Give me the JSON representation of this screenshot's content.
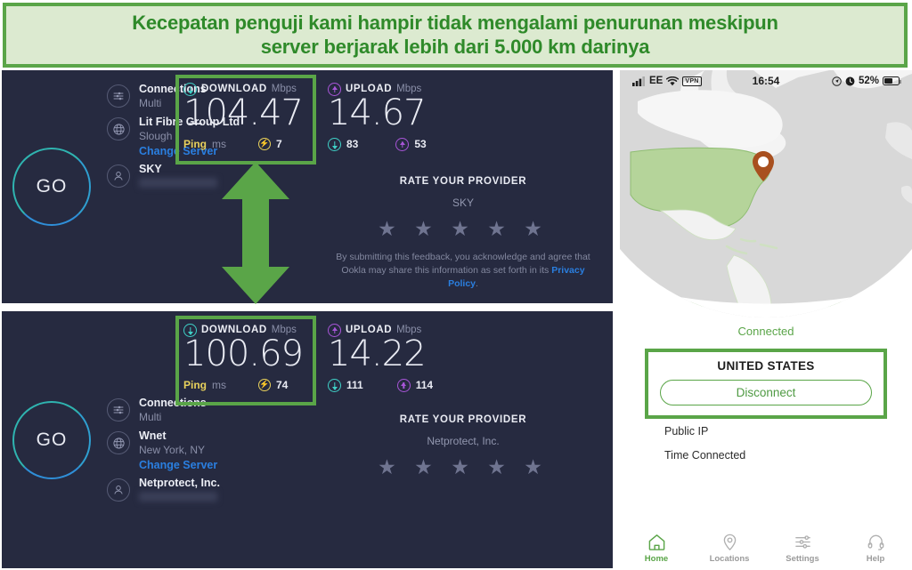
{
  "banner": {
    "line1": "Kecepatan penguji kami hampir tidak mengalami penurunan meskipun",
    "line2": "server berjarak lebih dari 5.000 km darinya"
  },
  "colors": {
    "green": "#5aa548",
    "banner_bg": "#dcead0",
    "panel_bg": "#262a40",
    "teal": "#3fd1c7",
    "purple": "#a855d8",
    "yellow": "#e9d25c",
    "link_blue": "#2a7fe0",
    "pin_brown": "#a8501f"
  },
  "speedtests": [
    {
      "go_label": "GO",
      "connections": {
        "title": "Connections",
        "sub": "Multi"
      },
      "server": {
        "title": "Lit Fibre Group Ltd",
        "sub": "Slough",
        "link": "Change Server"
      },
      "provider": {
        "title": "SKY",
        "ip": ""
      },
      "download": {
        "label": "DOWNLOAD",
        "unit": "Mbps",
        "value": "104.47"
      },
      "upload": {
        "label": "UPLOAD",
        "unit": "Mbps",
        "value": "14.67"
      },
      "ping": {
        "label": "Ping",
        "unit": "ms",
        "value": "7"
      },
      "sub_download": "83",
      "sub_upload": "53",
      "rate": {
        "title": "RATE YOUR PROVIDER",
        "name": "SKY",
        "stars": "★ ★ ★ ★ ★",
        "note_1": "By submitting this feedback, you acknowledge and agree that",
        "note_2": "Ookla may share this information as set forth in its ",
        "note_link_1": "Privacy",
        "note_link_2": "Policy",
        "note_end": "."
      }
    },
    {
      "go_label": "GO",
      "connections": {
        "title": "Connections",
        "sub": "Multi"
      },
      "server": {
        "title": "Wnet",
        "sub": "New York, NY",
        "link": "Change Server"
      },
      "provider": {
        "title": "Netprotect, Inc.",
        "ip": ""
      },
      "download": {
        "label": "DOWNLOAD",
        "unit": "Mbps",
        "value": "100.69"
      },
      "upload": {
        "label": "UPLOAD",
        "unit": "Mbps",
        "value": "14.22"
      },
      "ping": {
        "label": "Ping",
        "unit": "ms",
        "value": "74"
      },
      "sub_download": "111",
      "sub_upload": "114",
      "rate": {
        "title": "RATE YOUR PROVIDER",
        "name": "Netprotect, Inc.",
        "stars": "★ ★ ★ ★ ★"
      }
    }
  ],
  "phone": {
    "statusbar": {
      "carrier": "EE",
      "vpn": "VPN",
      "time": "16:54",
      "battery_percent": "52%"
    },
    "connection": {
      "status": "Connected",
      "country": "UNITED STATES",
      "disconnect_label": "Disconnect"
    },
    "details": [
      {
        "label": "Public IP",
        "value": ""
      },
      {
        "label": "Time Connected",
        "value": ""
      }
    ],
    "tabs": [
      {
        "label": "Home",
        "icon": "home-icon",
        "active": true
      },
      {
        "label": "Locations",
        "icon": "pin-icon",
        "active": false
      },
      {
        "label": "Settings",
        "icon": "sliders-icon",
        "active": false
      },
      {
        "label": "Help",
        "icon": "headset-icon",
        "active": false
      }
    ]
  }
}
